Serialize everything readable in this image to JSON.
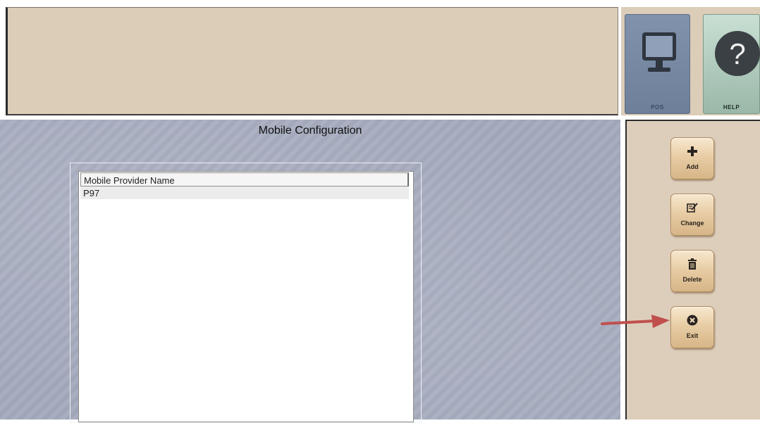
{
  "page": {
    "title": "Mobile Configuration"
  },
  "list": {
    "column_header": "Mobile Provider Name",
    "rows": [
      "P97"
    ]
  },
  "top_tiles": [
    {
      "label": "POS",
      "icon": "monitor-icon"
    },
    {
      "label": "HELP",
      "icon": "question-mark-icon"
    }
  ],
  "actions": {
    "add": {
      "label": "Add",
      "icon": "plus-icon"
    },
    "change": {
      "label": "Change",
      "icon": "edit-icon"
    },
    "delete": {
      "label": "Delete",
      "icon": "trash-icon"
    },
    "exit": {
      "label": "Exit",
      "icon": "close-circle-icon"
    }
  },
  "colors": {
    "panel_tan": "#dccdb8",
    "main_background": "#a5abbe",
    "button_tan": "#e8cda5",
    "arrow": "#c0504d"
  }
}
